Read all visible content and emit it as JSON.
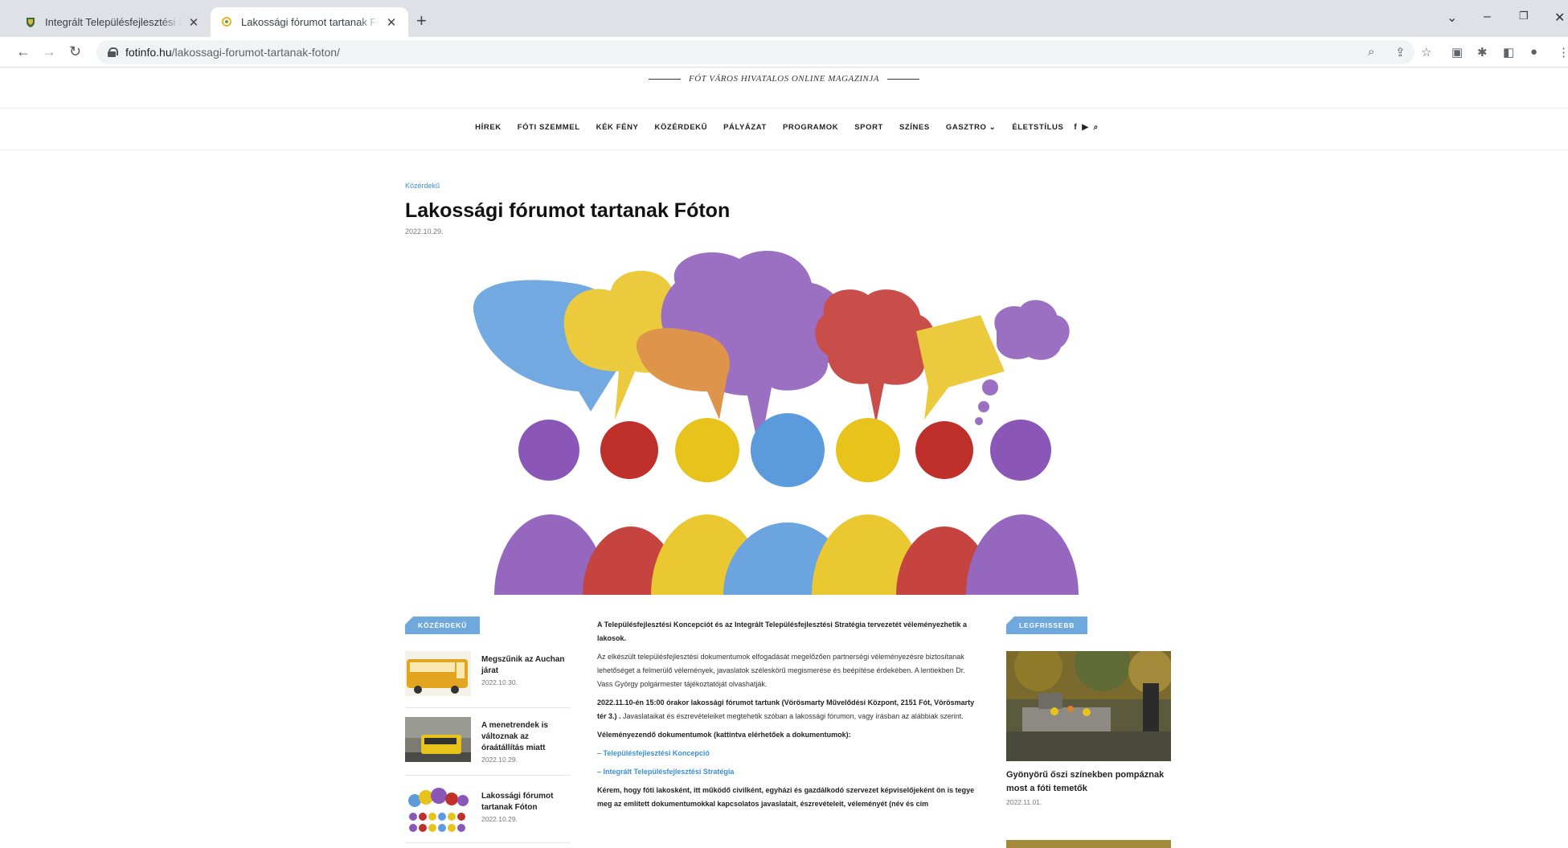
{
  "browser": {
    "tabs": [
      {
        "title": "Integrált Településfejlesztési Stratégia",
        "active": false
      },
      {
        "title": "Lakossági fórumot tartanak Fóton",
        "active": true
      }
    ],
    "url_host": "fotinfo.hu",
    "url_path": "/lakossagi-forumot-tartanak-foton/"
  },
  "site": {
    "tagline": "FÓT VÁROS HIVATALOS ONLINE MAGAZINJA",
    "nav": [
      "HÍREK",
      "FÓTI SZEMMEL",
      "KÉK FÉNY",
      "KÖZÉRDEKŰ",
      "PÁLYÁZAT",
      "PROGRAMOK",
      "SPORT",
      "SZÍNES",
      "GASZTRO",
      "ÉLETSTÍLUS"
    ]
  },
  "article": {
    "category": "Közérdekű",
    "title": "Lakossági fórumot tartanak Fóton",
    "date": "2022.10.29.",
    "lead": "A Településfejlesztési Koncepciót és az Integrált Településfejlesztési Stratégia tervezetét véleményezhetik a lakosok.",
    "p1": "Az elkészült településfejlesztési dokumentumok elfogadását megelőzően partnerségi véleményezésre biztosítanak lehetőséget a felmerülő vélemények, javaslatok széleskörű megismerése és beépítése érdekében. A lentiekben Dr. Vass György polgármester tájékoztatóját olvashatják.",
    "p2_bold": "2022.11.10-én 15:00 órakor lakossági fórumot tartunk (Vörösmarty Művelődési Központ, 2151 Fót, Vörösmarty tér 3.) .",
    "p2_rest": "Javaslataikat és észrevételeiket megtehetik szóban a lakossági fórumon, vagy írásban az alábbiak szerint.",
    "p3": "Véleményezendő dokumentumok (kattintva elérhetőek a dokumentumok):",
    "link1": "– Településfejlesztési Koncepció",
    "link2": "– Integrált Településfejlesztési Stratégia",
    "p4": "Kérem, hogy fóti lakosként, itt működő civilként, egyházi és gazdálkodó szervezet képviselőjeként ön is tegye meg az említett dokumentumokkal kapcsolatos javaslatait, észrevételeit, véleményét (név és cím"
  },
  "left_column": {
    "label": "KÖZÉRDEKŰ",
    "items": [
      {
        "title": "Megszűnik az Auchan járat",
        "date": "2022.10.30."
      },
      {
        "title": "A menetrendek is változnak az óraátállítás miatt",
        "date": "2022.10.29."
      },
      {
        "title": "Lakossági fórumot tartanak Fóton",
        "date": "2022.10.29."
      }
    ]
  },
  "right_column": {
    "label": "LEGFRISSEBB",
    "item": {
      "title": "Gyönyörű őszi színekben pompáznak most a fóti temetők",
      "date": "2022.11.01."
    }
  },
  "colors": {
    "accent": "#6fa8dc",
    "link": "#3a8fd6",
    "purple": "#8a57b8",
    "red": "#c0302b",
    "yellow": "#e8c31c",
    "blue": "#5b9bdc",
    "orange": "#d9822b"
  }
}
